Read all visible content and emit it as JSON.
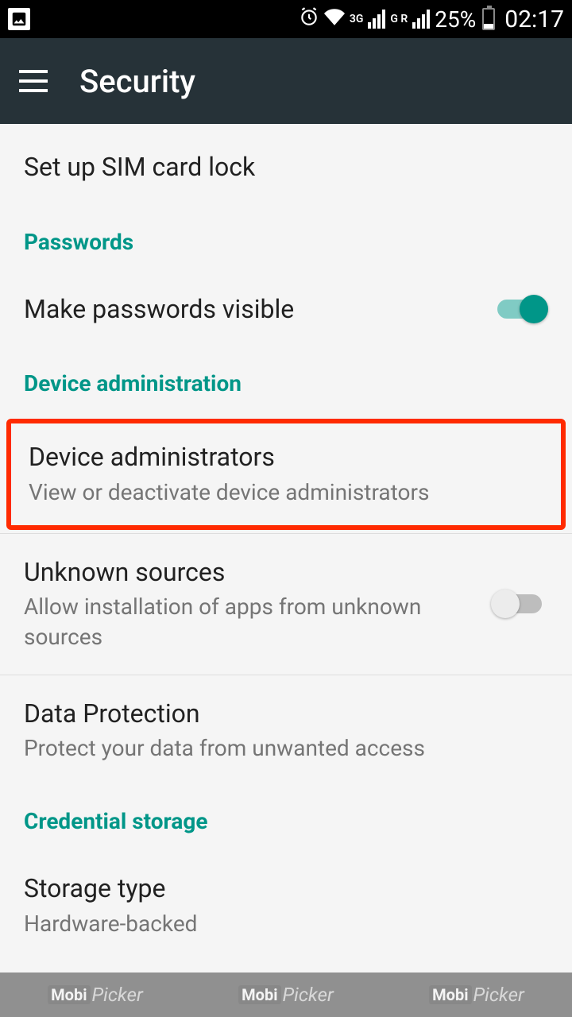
{
  "statusBar": {
    "network1": "3G",
    "network2": "G R",
    "batteryPercent": "25%",
    "time": "02:17"
  },
  "appBar": {
    "title": "Security"
  },
  "items": {
    "simLock": {
      "title": "Set up SIM card lock"
    },
    "passwordsHeader": "Passwords",
    "makeVisible": {
      "title": "Make passwords visible"
    },
    "deviceAdminHeader": "Device administration",
    "deviceAdmins": {
      "title": "Device administrators",
      "subtitle": "View or deactivate device administrators"
    },
    "unknownSources": {
      "title": "Unknown sources",
      "subtitle": "Allow installation of apps from unknown sources"
    },
    "dataProtection": {
      "title": "Data Protection",
      "subtitle": "Protect your data from unwanted access"
    },
    "credentialHeader": "Credential storage",
    "storageType": {
      "title": "Storage type",
      "subtitle": "Hardware-backed"
    }
  },
  "watermark": {
    "brand1": "Mobi",
    "brand2": "Picker"
  }
}
